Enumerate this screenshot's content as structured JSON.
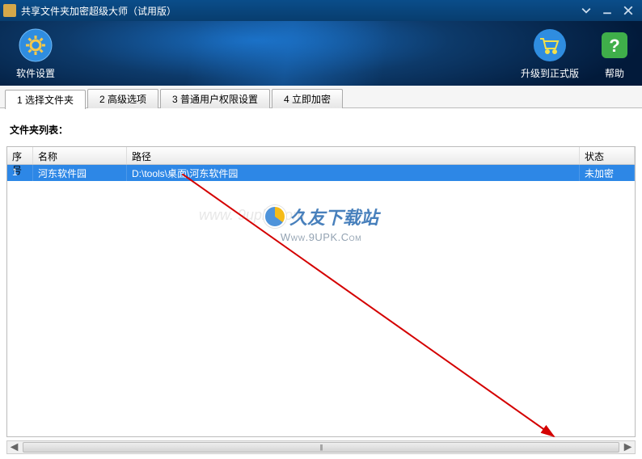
{
  "window": {
    "title": "共享文件夹加密超级大师（试用版）"
  },
  "toolbar": {
    "settings": "软件设置",
    "upgrade": "升级到正式版",
    "help": "帮助"
  },
  "tabs": [
    {
      "label": "1 选择文件夹",
      "active": true
    },
    {
      "label": "2 高级选项",
      "active": false
    },
    {
      "label": "3 普通用户权限设置",
      "active": false
    },
    {
      "label": "4 立即加密",
      "active": false
    }
  ],
  "list_label": "文件夹列表：",
  "table": {
    "headers": {
      "index": "序号",
      "name": "名称",
      "path": "路径",
      "status": "状态"
    },
    "rows": [
      {
        "index": "1",
        "name": "河东软件园",
        "path": "D:\\tools\\桌面\\河东软件园",
        "status": "未加密"
      }
    ]
  },
  "watermark": {
    "bg_text": "www. 9upk .com",
    "main_text": "久友下载站",
    "url": "Www.9UPK.Com"
  }
}
